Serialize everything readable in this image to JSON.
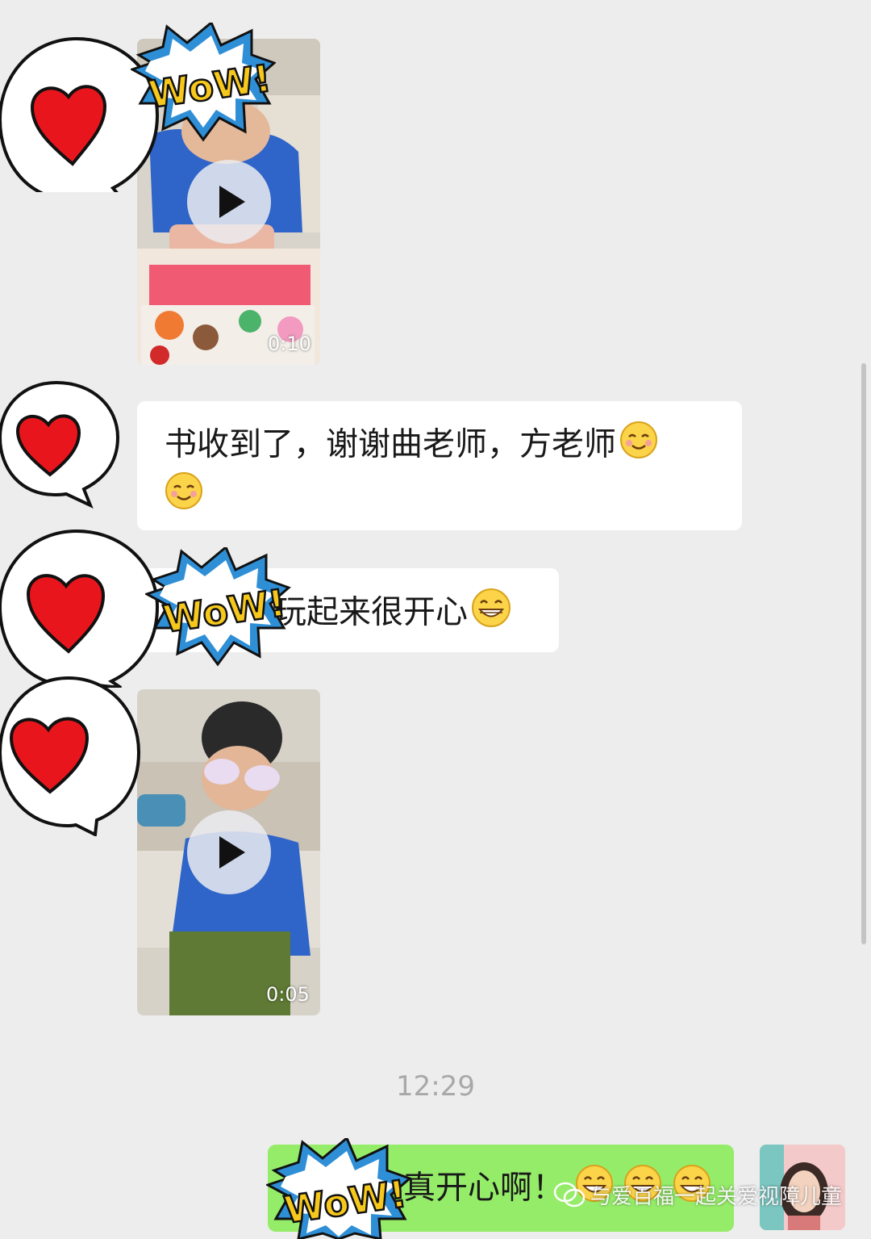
{
  "messages": [
    {
      "type": "video",
      "duration": "0:10"
    },
    {
      "type": "text",
      "text": "书收到了，谢谢曲老师，方老师",
      "emoji": "blush-emoji"
    },
    {
      "type": "text",
      "text": "玩起来很开心",
      "emoji": "grin-emoji"
    },
    {
      "type": "video",
      "duration": "0:05"
    }
  ],
  "timestamp": "12:29",
  "my_message": {
    "text": "真开心啊！",
    "emoji": "grin-emoji"
  },
  "watermark": "与爱百福一起关爱视障儿童",
  "stickers": {
    "wow_text": "WoW!"
  },
  "colors": {
    "bg": "#ededed",
    "mine_bubble": "#95ec69",
    "other_bubble": "#ffffff",
    "heart": "#e8161c",
    "wow_yellow": "#f7c81c",
    "wow_blue": "#2f8fd6"
  }
}
